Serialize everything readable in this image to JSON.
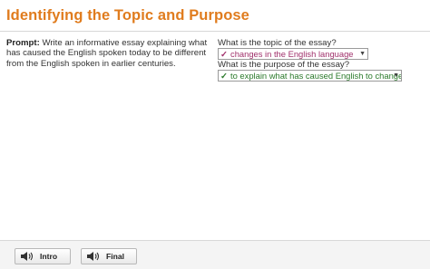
{
  "header": {
    "title": "Identifying the Topic and Purpose"
  },
  "prompt": {
    "label": "Prompt:",
    "text": " Write an informative essay explaining what has caused the English spoken today to be different from the English spoken in earlier centuries."
  },
  "questions": [
    {
      "label": "What is the topic of the essay?",
      "selected": "changes in the English language",
      "status": "correct"
    },
    {
      "label": "What is the purpose of the essay?",
      "selected": "to explain what has caused English to change",
      "status": "correct"
    }
  ],
  "footer": {
    "buttons": [
      {
        "label": "Intro",
        "icon": "speaker-icon"
      },
      {
        "label": "Final",
        "icon": "speaker-icon"
      }
    ]
  },
  "colors": {
    "title": "#e07c1e",
    "topic_answer": "#a0306b",
    "purpose_answer": "#2b7a2b"
  }
}
